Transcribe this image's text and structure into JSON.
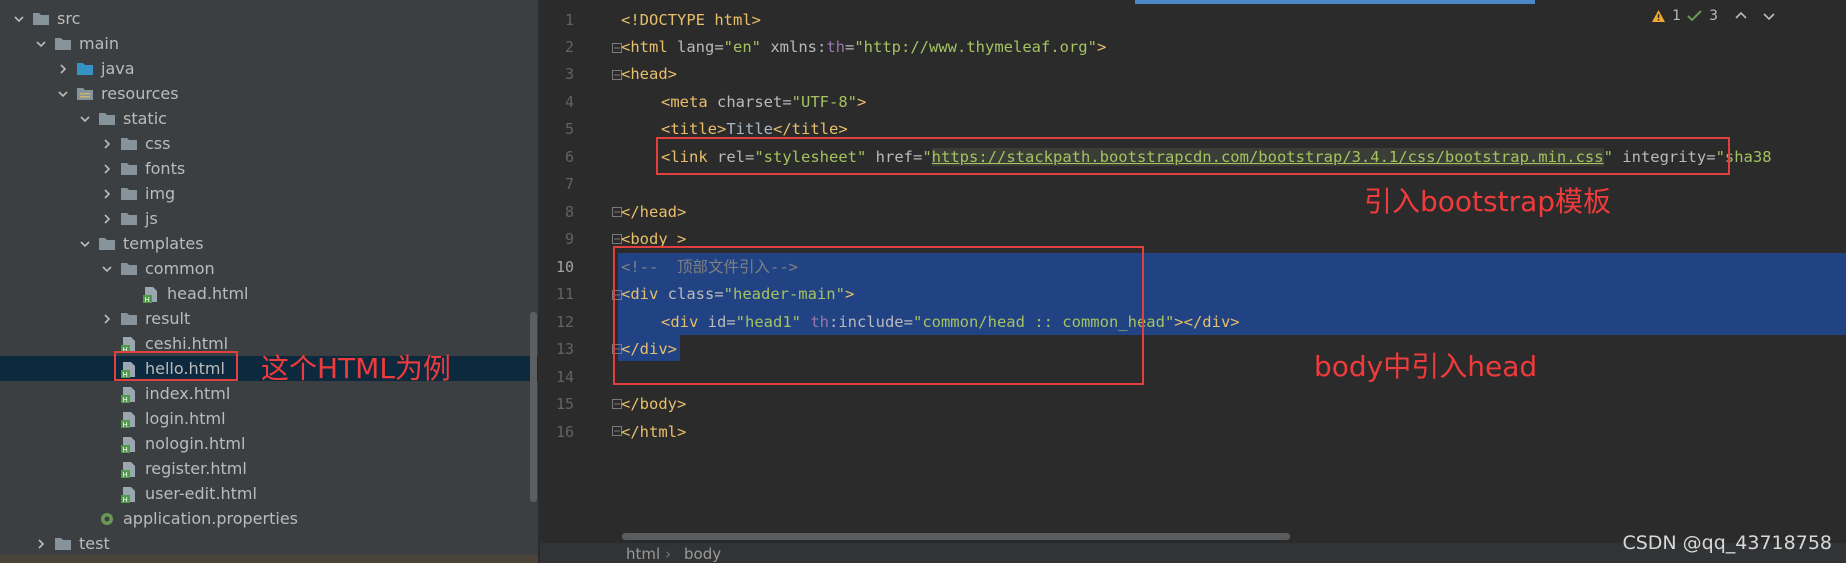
{
  "sidebar": {
    "items": [
      {
        "label": "src",
        "type": "folder",
        "level": 1,
        "arrow": "down"
      },
      {
        "label": "main",
        "type": "folder",
        "level": 2,
        "arrow": "down"
      },
      {
        "label": "java",
        "type": "folder-blue",
        "level": 3,
        "arrow": "right"
      },
      {
        "label": "resources",
        "type": "folder-res",
        "level": 3,
        "arrow": "down"
      },
      {
        "label": "static",
        "type": "folder",
        "level": 4,
        "arrow": "down"
      },
      {
        "label": "css",
        "type": "folder",
        "level": 5,
        "arrow": "right"
      },
      {
        "label": "fonts",
        "type": "folder",
        "level": 5,
        "arrow": "right"
      },
      {
        "label": "img",
        "type": "folder",
        "level": 5,
        "arrow": "right"
      },
      {
        "label": "js",
        "type": "folder",
        "level": 5,
        "arrow": "right"
      },
      {
        "label": "templates",
        "type": "folder",
        "level": 4,
        "arrow": "down"
      },
      {
        "label": "common",
        "type": "folder",
        "level": 5,
        "arrow": "down"
      },
      {
        "label": "head.html",
        "type": "html",
        "level": 6,
        "arrow": "none"
      },
      {
        "label": "result",
        "type": "folder",
        "level": 5,
        "arrow": "right"
      },
      {
        "label": "ceshi.html",
        "type": "html",
        "level": 5,
        "arrow": "none"
      },
      {
        "label": "hello.html",
        "type": "html",
        "level": 5,
        "arrow": "none",
        "selected": true
      },
      {
        "label": "index.html",
        "type": "html",
        "level": 5,
        "arrow": "none"
      },
      {
        "label": "login.html",
        "type": "html",
        "level": 5,
        "arrow": "none"
      },
      {
        "label": "nologin.html",
        "type": "html",
        "level": 5,
        "arrow": "none"
      },
      {
        "label": "register.html",
        "type": "html",
        "level": 5,
        "arrow": "none"
      },
      {
        "label": "user-edit.html",
        "type": "html",
        "level": 5,
        "arrow": "none"
      },
      {
        "label": "application.properties",
        "type": "props",
        "level": 4,
        "arrow": "none"
      },
      {
        "label": "test",
        "type": "folder",
        "level": 2,
        "arrow": "right"
      }
    ]
  },
  "annotations": {
    "hello_example": "这个HTML为例",
    "bootstrap": "引入bootstrap模板",
    "body_head": "body中引入head"
  },
  "editor": {
    "line_numbers": [
      "1",
      "2",
      "3",
      "4",
      "5",
      "6",
      "7",
      "8",
      "9",
      "10",
      "11",
      "12",
      "13",
      "14",
      "15",
      "16"
    ],
    "current_line": "10",
    "code": {
      "l1": "<!DOCTYPE html>",
      "l2_tag": "<html",
      "l2_attr1": " lang=",
      "l2_val1": "\"en\"",
      "l2_attr2": " xmlns:",
      "l2_ns": "th",
      "l2_eq": "=",
      "l2_val2": "\"http://www.thymeleaf.org\"",
      "l2_end": ">",
      "l3": "<head>",
      "l4_tag": "<meta",
      "l4_attr": " charset=",
      "l4_val": "\"UTF-8\"",
      "l4_end": ">",
      "l5_open": "<title>",
      "l5_text": "Title",
      "l5_close": "</title>",
      "l6_tag": "<link",
      "l6_attr1": " rel=",
      "l6_val1": "\"stylesheet\"",
      "l6_attr2": " href=",
      "l6_q1": "\"",
      "l6_url": "https://stackpath.bootstrapcdn.com/bootstrap/3.4.1/css/bootstrap.min.css",
      "l6_q2": "\"",
      "l6_attr3": " integrity=",
      "l6_val3": "\"sha38",
      "l8": "</head>",
      "l9": "<body >",
      "l10": "<!--  顶部文件引入-->",
      "l11_tag": "<div",
      "l11_attr": " class=",
      "l11_val": "\"header-main\"",
      "l11_end": ">",
      "l12_tag": "<div",
      "l12_attr1": " id=",
      "l12_val1": "\"head1\"",
      "l12_ns": " th",
      "l12_attr2": ":include=",
      "l12_val2": "\"common/head :: common_head\"",
      "l12_end": "></div>",
      "l13": "</div>",
      "l15": "</body>",
      "l16": "</html>"
    },
    "status": {
      "warnings": "1",
      "checks": "3"
    },
    "breadcrumb": [
      "html",
      "body"
    ]
  },
  "watermark": "CSDN @qq_43718758",
  "colors": {
    "sidebar_bg": "#3c3f41",
    "editor_bg": "#2b2b2b",
    "selection": "#214283",
    "tag": "#e8bf6a",
    "value": "#a5c261",
    "annotation": "#ef3b3b"
  }
}
